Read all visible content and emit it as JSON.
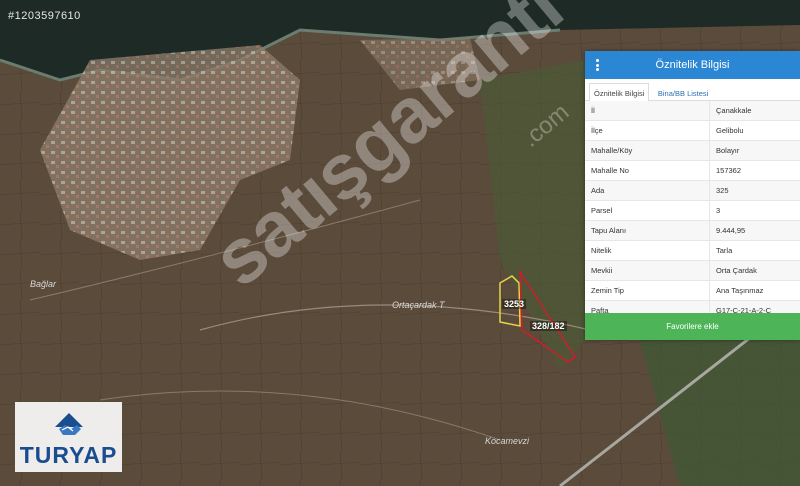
{
  "listing_id": "#1203597610",
  "map": {
    "labels": [
      {
        "text": "Bağlar"
      },
      {
        "text": "Ortaçardak T"
      },
      {
        "text": "Kocamevzi"
      }
    ],
    "parcel_labels": [
      "3253",
      "328/182"
    ],
    "watermark": "satışgaranti",
    "watermark_suffix": ".com"
  },
  "panel": {
    "title": "Öznitelik Bilgisi",
    "tabs": [
      {
        "label": "Öznitelik Bilgisi",
        "active": true
      },
      {
        "label": "Bina/BB Listesi",
        "active": false
      }
    ],
    "rows": [
      {
        "key": "İl",
        "value": "Çanakkale"
      },
      {
        "key": "İlçe",
        "value": "Gelibolu"
      },
      {
        "key": "Mahalle/Köy",
        "value": "Bolayır"
      },
      {
        "key": "Mahalle No",
        "value": "157362"
      },
      {
        "key": "Ada",
        "value": "325"
      },
      {
        "key": "Parsel",
        "value": "3"
      },
      {
        "key": "Tapu Alanı",
        "value": "9.444,95"
      },
      {
        "key": "Nitelik",
        "value": "Tarla"
      },
      {
        "key": "Mevkii",
        "value": "Orta Çardak"
      },
      {
        "key": "Zemin Tip",
        "value": "Ana Taşınmaz"
      },
      {
        "key": "Pafta",
        "value": "G17-C-21-A-2-C"
      }
    ],
    "favorite_button": "Favorilere ekle"
  },
  "logo": {
    "text": "TURYAP"
  },
  "colors": {
    "header": "#2b86d4",
    "button": "#4db558",
    "parcel_red": "#d11c2a",
    "parcel_yellow": "#e6d44a"
  }
}
